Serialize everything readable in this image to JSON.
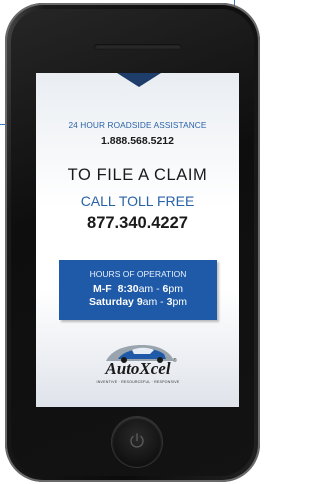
{
  "screen": {
    "roadside_title": "24 HOUR ROADSIDE ASSISTANCE",
    "roadside_phone": "1.888.568.5212",
    "claim_title": "TO FILE A CLAIM",
    "toll_free_label": "CALL TOLL FREE",
    "claim_phone": "877.340.4227",
    "hours": {
      "title": "HOURS OF OPERATION",
      "line1_days": "M-F",
      "line1_start": "8:30",
      "line1_start_suffix": "am",
      "line1_sep": " - ",
      "line1_end": "6",
      "line1_end_suffix": "pm",
      "line2_days": "Saturday",
      "line2_start": "9",
      "line2_start_suffix": "am",
      "line2_sep": " - ",
      "line2_end": "3",
      "line2_end_suffix": "pm"
    },
    "logo": {
      "name": "AutoXcel",
      "registered_mark": "®",
      "tagline": "INVENTIVE · RESOURCEFUL · RESPONSIVE"
    }
  },
  "icons": {
    "home_button": "power-icon",
    "logo_car": "car-icon"
  },
  "colors": {
    "accent_blue": "#2a62a8",
    "hours_box": "#1e5aa8",
    "notch": "#1f3d6b",
    "phone_body": "#0e0e0e"
  }
}
